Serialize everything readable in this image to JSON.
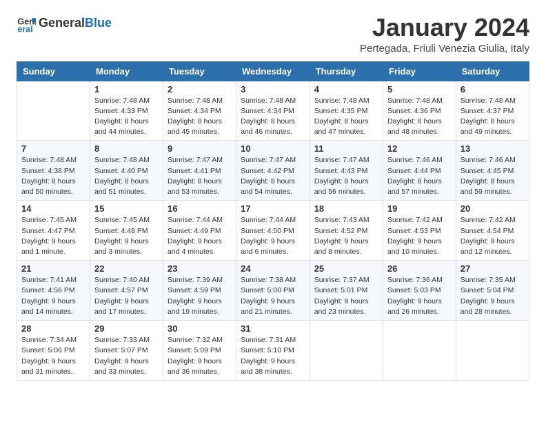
{
  "logo": {
    "text_general": "General",
    "text_blue": "Blue"
  },
  "header": {
    "month": "January 2024",
    "location": "Pertegada, Friuli Venezia Giulia, Italy"
  },
  "days_of_week": [
    "Sunday",
    "Monday",
    "Tuesday",
    "Wednesday",
    "Thursday",
    "Friday",
    "Saturday"
  ],
  "weeks": [
    [
      {
        "day": "",
        "info": ""
      },
      {
        "day": "1",
        "info": "Sunrise: 7:48 AM\nSunset: 4:33 PM\nDaylight: 8 hours\nand 44 minutes."
      },
      {
        "day": "2",
        "info": "Sunrise: 7:48 AM\nSunset: 4:34 PM\nDaylight: 8 hours\nand 45 minutes."
      },
      {
        "day": "3",
        "info": "Sunrise: 7:48 AM\nSunset: 4:34 PM\nDaylight: 8 hours\nand 46 minutes."
      },
      {
        "day": "4",
        "info": "Sunrise: 7:48 AM\nSunset: 4:35 PM\nDaylight: 8 hours\nand 47 minutes."
      },
      {
        "day": "5",
        "info": "Sunrise: 7:48 AM\nSunset: 4:36 PM\nDaylight: 8 hours\nand 48 minutes."
      },
      {
        "day": "6",
        "info": "Sunrise: 7:48 AM\nSunset: 4:37 PM\nDaylight: 8 hours\nand 49 minutes."
      }
    ],
    [
      {
        "day": "7",
        "info": "Sunrise: 7:48 AM\nSunset: 4:38 PM\nDaylight: 8 hours\nand 50 minutes."
      },
      {
        "day": "8",
        "info": "Sunrise: 7:48 AM\nSunset: 4:40 PM\nDaylight: 8 hours\nand 51 minutes."
      },
      {
        "day": "9",
        "info": "Sunrise: 7:47 AM\nSunset: 4:41 PM\nDaylight: 8 hours\nand 53 minutes."
      },
      {
        "day": "10",
        "info": "Sunrise: 7:47 AM\nSunset: 4:42 PM\nDaylight: 8 hours\nand 54 minutes."
      },
      {
        "day": "11",
        "info": "Sunrise: 7:47 AM\nSunset: 4:43 PM\nDaylight: 8 hours\nand 56 minutes."
      },
      {
        "day": "12",
        "info": "Sunrise: 7:46 AM\nSunset: 4:44 PM\nDaylight: 8 hours\nand 57 minutes."
      },
      {
        "day": "13",
        "info": "Sunrise: 7:46 AM\nSunset: 4:45 PM\nDaylight: 8 hours\nand 59 minutes."
      }
    ],
    [
      {
        "day": "14",
        "info": "Sunrise: 7:45 AM\nSunset: 4:47 PM\nDaylight: 9 hours\nand 1 minute."
      },
      {
        "day": "15",
        "info": "Sunrise: 7:45 AM\nSunset: 4:48 PM\nDaylight: 9 hours\nand 3 minutes."
      },
      {
        "day": "16",
        "info": "Sunrise: 7:44 AM\nSunset: 4:49 PM\nDaylight: 9 hours\nand 4 minutes."
      },
      {
        "day": "17",
        "info": "Sunrise: 7:44 AM\nSunset: 4:50 PM\nDaylight: 9 hours\nand 6 minutes."
      },
      {
        "day": "18",
        "info": "Sunrise: 7:43 AM\nSunset: 4:52 PM\nDaylight: 9 hours\nand 8 minutes."
      },
      {
        "day": "19",
        "info": "Sunrise: 7:42 AM\nSunset: 4:53 PM\nDaylight: 9 hours\nand 10 minutes."
      },
      {
        "day": "20",
        "info": "Sunrise: 7:42 AM\nSunset: 4:54 PM\nDaylight: 9 hours\nand 12 minutes."
      }
    ],
    [
      {
        "day": "21",
        "info": "Sunrise: 7:41 AM\nSunset: 4:56 PM\nDaylight: 9 hours\nand 14 minutes."
      },
      {
        "day": "22",
        "info": "Sunrise: 7:40 AM\nSunset: 4:57 PM\nDaylight: 9 hours\nand 17 minutes."
      },
      {
        "day": "23",
        "info": "Sunrise: 7:39 AM\nSunset: 4:59 PM\nDaylight: 9 hours\nand 19 minutes."
      },
      {
        "day": "24",
        "info": "Sunrise: 7:38 AM\nSunset: 5:00 PM\nDaylight: 9 hours\nand 21 minutes."
      },
      {
        "day": "25",
        "info": "Sunrise: 7:37 AM\nSunset: 5:01 PM\nDaylight: 9 hours\nand 23 minutes."
      },
      {
        "day": "26",
        "info": "Sunrise: 7:36 AM\nSunset: 5:03 PM\nDaylight: 9 hours\nand 26 minutes."
      },
      {
        "day": "27",
        "info": "Sunrise: 7:35 AM\nSunset: 5:04 PM\nDaylight: 9 hours\nand 28 minutes."
      }
    ],
    [
      {
        "day": "28",
        "info": "Sunrise: 7:34 AM\nSunset: 5:06 PM\nDaylight: 9 hours\nand 31 minutes."
      },
      {
        "day": "29",
        "info": "Sunrise: 7:33 AM\nSunset: 5:07 PM\nDaylight: 9 hours\nand 33 minutes."
      },
      {
        "day": "30",
        "info": "Sunrise: 7:32 AM\nSunset: 5:09 PM\nDaylight: 9 hours\nand 36 minutes."
      },
      {
        "day": "31",
        "info": "Sunrise: 7:31 AM\nSunset: 5:10 PM\nDaylight: 9 hours\nand 38 minutes."
      },
      {
        "day": "",
        "info": ""
      },
      {
        "day": "",
        "info": ""
      },
      {
        "day": "",
        "info": ""
      }
    ]
  ]
}
